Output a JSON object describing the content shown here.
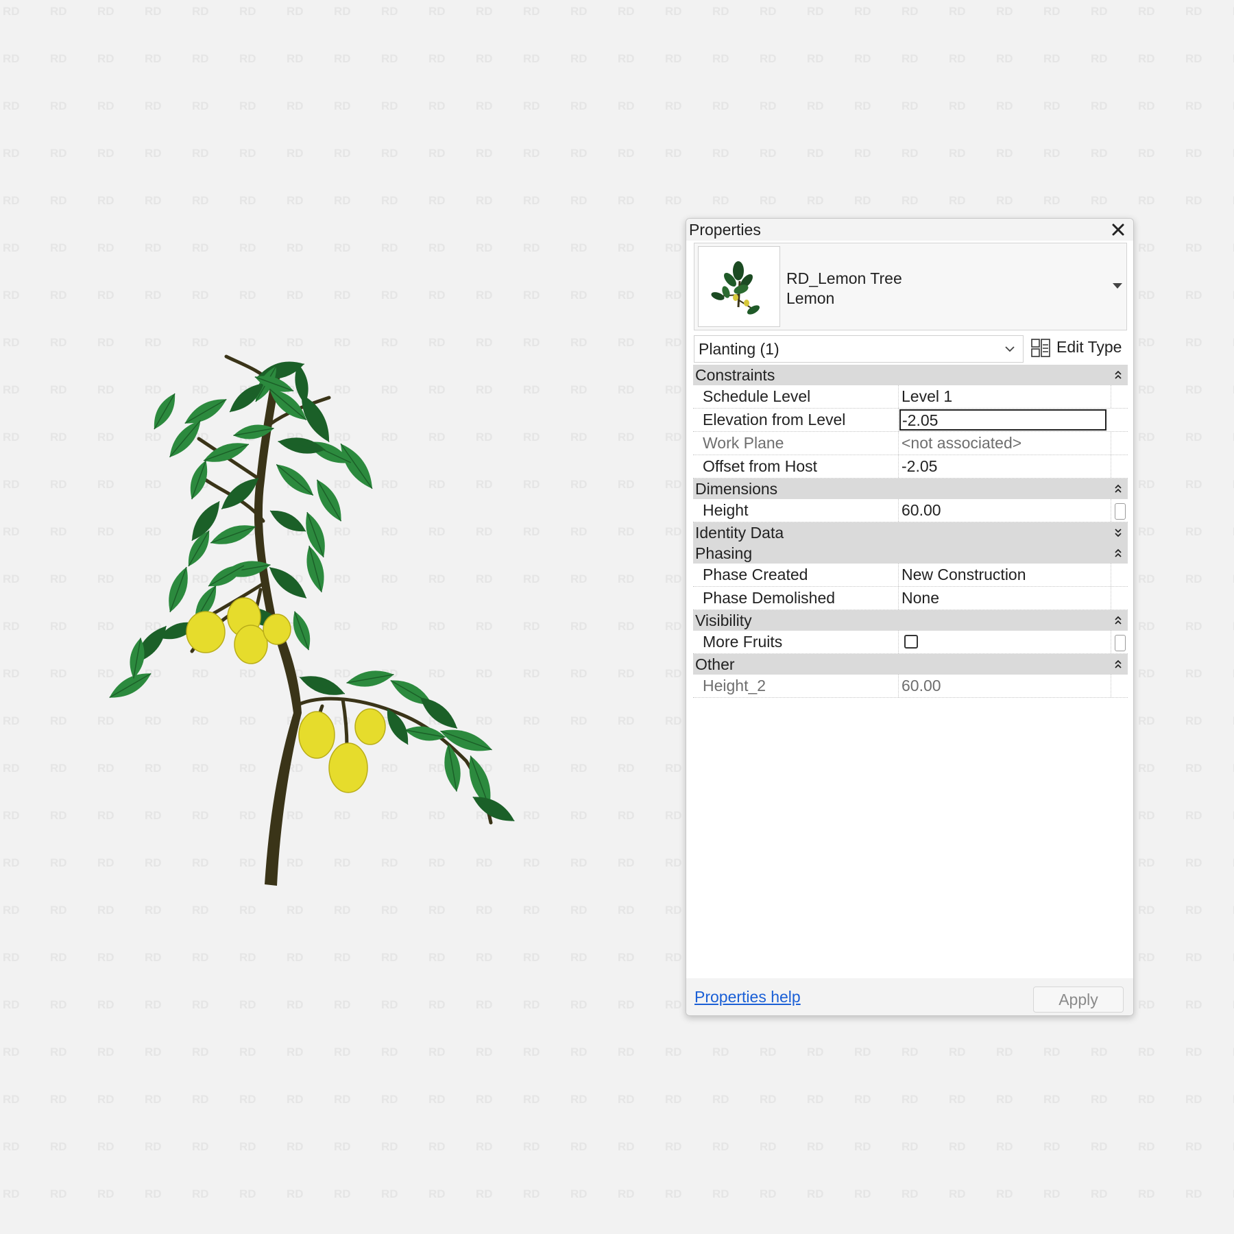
{
  "watermark_text": "RD",
  "colors": {
    "leaf": "#2c8a3e",
    "leaf_dark": "#1b6028",
    "fruit": "#e6dc2c",
    "trunk": "#3a3418",
    "link": "#1a5fd6",
    "group_bg": "#dadada"
  },
  "properties": {
    "title": "Properties",
    "type_selector": {
      "family": "RD_Lemon Tree",
      "type": "Lemon"
    },
    "instance_filter": "Planting (1)",
    "edit_type_label": "Edit Type",
    "groups": {
      "constraints": {
        "label": "Constraints",
        "rows": [
          {
            "name": "Schedule Level",
            "value": "Level 1"
          },
          {
            "name": "Elevation from Level",
            "value": "-2.05"
          },
          {
            "name": "Work Plane",
            "value": "<not associated>"
          },
          {
            "name": "Offset from Host",
            "value": "-2.05"
          }
        ]
      },
      "dimensions": {
        "label": "Dimensions",
        "rows": [
          {
            "name": "Height",
            "value": "60.00"
          }
        ]
      },
      "identity": {
        "label": "Identity Data"
      },
      "phasing": {
        "label": "Phasing",
        "rows": [
          {
            "name": "Phase Created",
            "value": "New Construction"
          },
          {
            "name": "Phase Demolished",
            "value": "None"
          }
        ]
      },
      "visibility": {
        "label": "Visibility",
        "rows": [
          {
            "name": "More Fruits",
            "checked": false
          }
        ]
      },
      "other": {
        "label": "Other",
        "rows": [
          {
            "name": "Height_2",
            "value": "60.00"
          }
        ]
      }
    },
    "help_link": "Properties help",
    "apply_label": "Apply"
  }
}
